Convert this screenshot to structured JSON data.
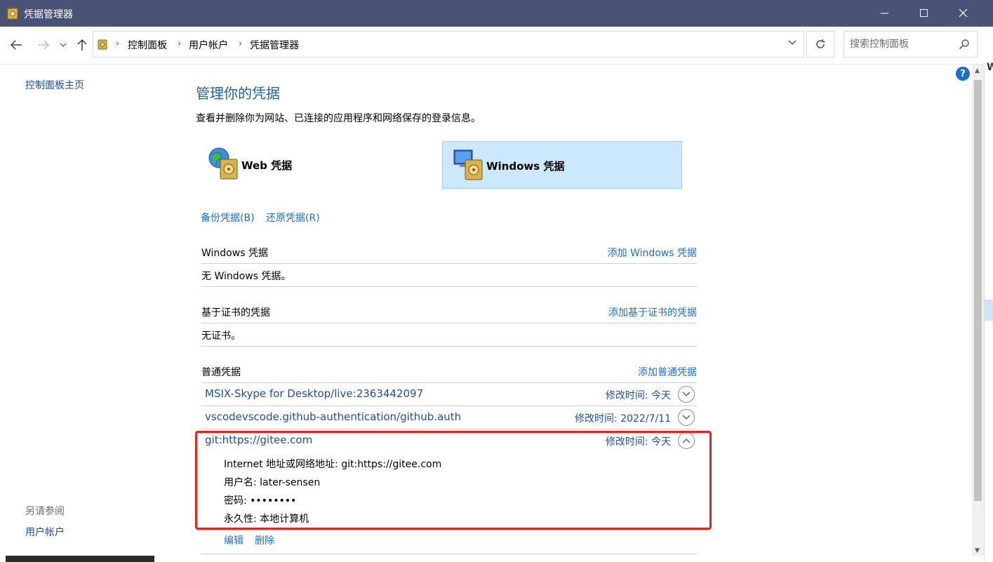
{
  "window": {
    "title": "凭据管理器"
  },
  "address": {
    "crumbs": [
      "控制面板",
      "用户帐户",
      "凭据管理器"
    ],
    "search_placeholder": "搜索控制面板"
  },
  "left_nav": {
    "home": "控制面板主页",
    "see_also_label": "另请参阅",
    "see_also_link": "用户帐户"
  },
  "main": {
    "title": "管理你的凭据",
    "description": "查看并删除你为网站、已连接的应用程序和网络保存的登录信息。",
    "types": [
      {
        "label": "Web 凭据",
        "icon": "globe-vault-icon",
        "selected": false
      },
      {
        "label": "Windows 凭据",
        "icon": "monitor-vault-icon",
        "selected": true
      }
    ],
    "backup": "备份凭据(B)",
    "restore": "还原凭据(R)",
    "windows_section": {
      "title": "Windows 凭据",
      "add": "添加 Windows 凭据",
      "empty": "无 Windows 凭据。"
    },
    "cert_section": {
      "title": "基于证书的凭据",
      "add": "添加基于证书的凭据",
      "empty": "无证书。"
    },
    "generic_section": {
      "title": "普通凭据",
      "add": "添加普通凭据",
      "items": [
        {
          "name": "MSIX-Skype for Desktop/live:2363442097",
          "modified": "修改时间:  今天",
          "expanded": false
        },
        {
          "name": "vscodevscode.github-authentication/github.auth",
          "modified": "修改时间:  2022/7/11",
          "expanded": false
        },
        {
          "name": "git:https://gitee.com",
          "modified": "修改时间:  今天",
          "expanded": true
        }
      ],
      "detail": {
        "address": "Internet 地址或网络地址:  git:https://gitee.com",
        "username": "用户名:  later-sensen",
        "password": "密码:  ••••••••",
        "persistence": "永久性:  本地计算机",
        "edit": "编辑",
        "delete": "删除"
      }
    }
  },
  "colors": {
    "titlebar": "#4a5275",
    "link": "#1a6fce",
    "highlight": "#e8211b",
    "selected_bg": "#cce8ff"
  }
}
